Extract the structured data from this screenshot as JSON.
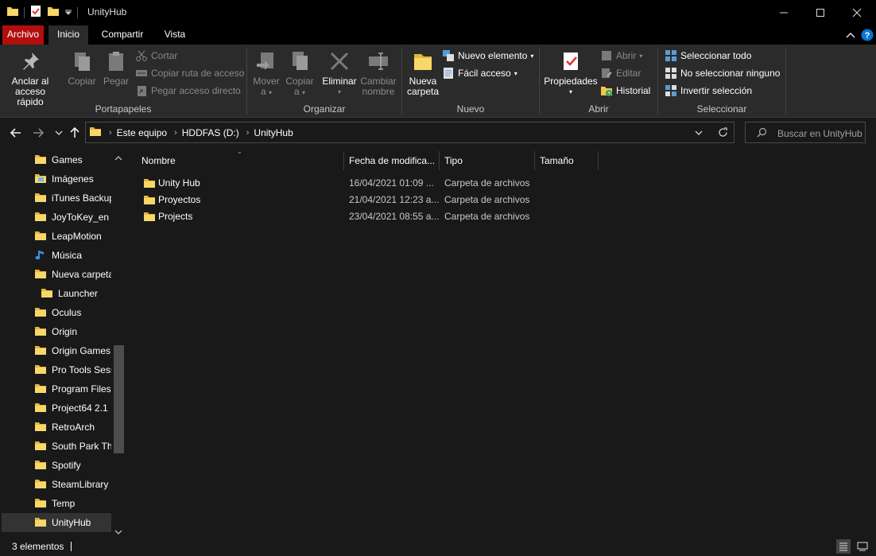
{
  "window": {
    "title": "UnityHub"
  },
  "tabs": {
    "file": "Archivo",
    "home": "Inicio",
    "share": "Compartir",
    "view": "Vista"
  },
  "ribbon": {
    "portapapeles": {
      "pin_line1": "Anclar al",
      "pin_line2": "acceso rápido",
      "copy": "Copiar",
      "paste": "Pegar",
      "cut": "Cortar",
      "copy_path": "Copiar ruta de acceso",
      "paste_shortcut": "Pegar acceso directo",
      "label": "Portapapeles"
    },
    "organizar": {
      "move_line1": "Mover",
      "move_line2": "a",
      "copyto_line1": "Copiar",
      "copyto_line2": "a",
      "delete": "Eliminar",
      "rename_line1": "Cambiar",
      "rename_line2": "nombre",
      "label": "Organizar"
    },
    "nuevo": {
      "newfolder_line1": "Nueva",
      "newfolder_line2": "carpeta",
      "new_item": "Nuevo elemento",
      "easy_access": "Fácil acceso",
      "label": "Nuevo"
    },
    "abrir": {
      "properties": "Propiedades",
      "open": "Abrir",
      "edit": "Editar",
      "history": "Historial",
      "label": "Abrir"
    },
    "seleccionar": {
      "select_all": "Seleccionar todo",
      "select_none": "No seleccionar ninguno",
      "invert": "Invertir selección",
      "label": "Seleccionar"
    }
  },
  "address": {
    "crumbs": [
      "Este equipo",
      "HDDFAS (D:)",
      "UnityHub"
    ]
  },
  "search": {
    "placeholder": "Buscar en UnityHub"
  },
  "navpane": {
    "items": [
      {
        "label": "Games",
        "icon": "folder-icon"
      },
      {
        "label": "Imágenes",
        "icon": "pictures-icon"
      },
      {
        "label": "iTunes Backup",
        "icon": "folder-icon"
      },
      {
        "label": "JoyToKey_en",
        "icon": "folder-icon"
      },
      {
        "label": "LeapMotion",
        "icon": "folder-icon"
      },
      {
        "label": "Música",
        "icon": "music-icon"
      },
      {
        "label": "Nueva carpeta",
        "icon": "folder-icon"
      },
      {
        "label": "Launcher",
        "icon": "folder-icon"
      },
      {
        "label": "Oculus",
        "icon": "folder-icon"
      },
      {
        "label": "Origin",
        "icon": "folder-icon"
      },
      {
        "label": "Origin Games",
        "icon": "folder-icon"
      },
      {
        "label": "Pro Tools Sessi",
        "icon": "folder-icon"
      },
      {
        "label": "Program Files",
        "icon": "folder-icon"
      },
      {
        "label": "Project64 2.1",
        "icon": "folder-icon"
      },
      {
        "label": "RetroArch",
        "icon": "folder-icon"
      },
      {
        "label": "South Park The",
        "icon": "folder-icon"
      },
      {
        "label": "Spotify",
        "icon": "folder-icon"
      },
      {
        "label": "SteamLibrary",
        "icon": "folder-icon"
      },
      {
        "label": "Temp",
        "icon": "folder-icon"
      },
      {
        "label": "UnityHub",
        "icon": "folder-icon"
      }
    ]
  },
  "columns": {
    "name": "Nombre",
    "date": "Fecha de modifica...",
    "type": "Tipo",
    "size": "Tamaño"
  },
  "files": [
    {
      "name": "Unity Hub",
      "date": "16/04/2021 01:09 ...",
      "type": "Carpeta de archivos"
    },
    {
      "name": "Proyectos",
      "date": "21/04/2021 12:23 a...",
      "type": "Carpeta de archivos"
    },
    {
      "name": "Projects",
      "date": "23/04/2021 08:55 a...",
      "type": "Carpeta de archivos"
    }
  ],
  "status": {
    "count": "3 elementos"
  },
  "colors": {
    "accent_file_tab": "#b20e0e",
    "folder_yellow": "#f4c64b",
    "help_blue": "#0a74d6"
  }
}
